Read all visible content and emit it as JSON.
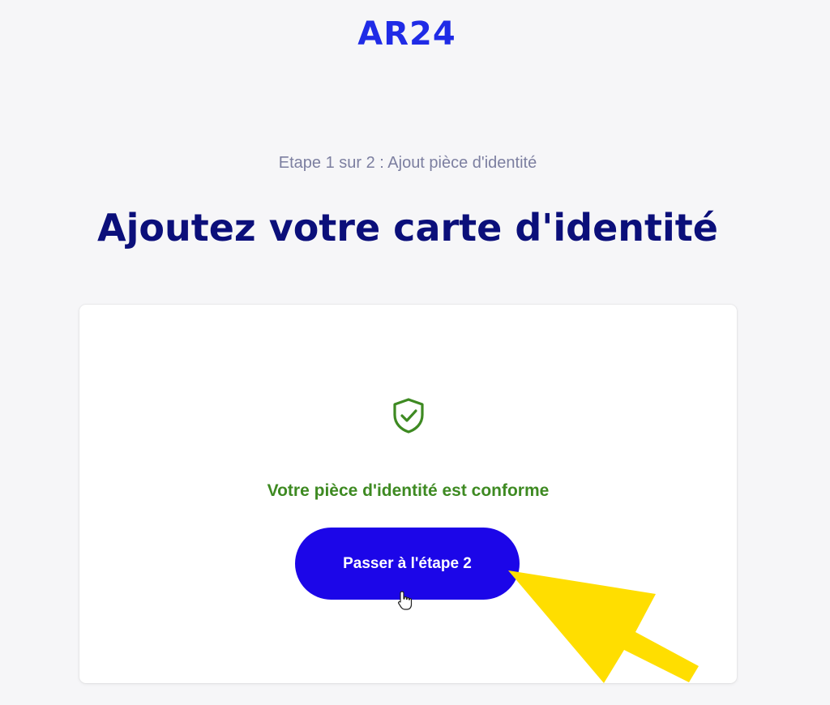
{
  "brand": {
    "logo_text": "AR24",
    "accent_color": "#1f2be6"
  },
  "header": {
    "step_label": "Etape 1 sur 2 : Ajout pièce d'identité",
    "title": "Ajoutez votre carte d'identité"
  },
  "card": {
    "icon": "shield-check-icon",
    "status_text": "Votre pièce d'identité est conforme",
    "status_color": "#3e8a22",
    "button_label": "Passer à l'étape 2",
    "button_color": "#1c06e8"
  },
  "annotation": {
    "icon": "yellow-arrow-pointer",
    "color": "#ffde00"
  }
}
